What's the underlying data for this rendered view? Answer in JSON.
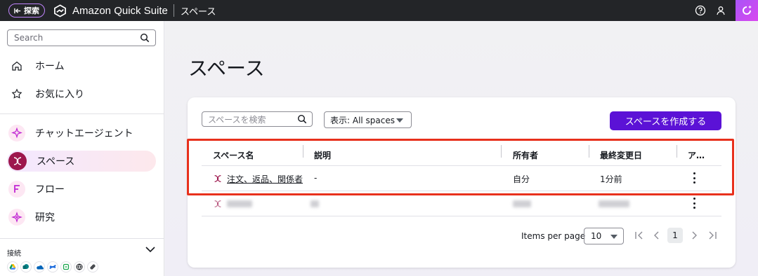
{
  "topbar": {
    "explore_label": "探索",
    "app_title": "Amazon Quick Suite",
    "page_crumb": "スペース",
    "icons": [
      "help-icon",
      "user-icon",
      "ai-assistant-icon"
    ]
  },
  "sidebar": {
    "search_placeholder": "Search",
    "items": [
      {
        "label": "ホーム",
        "icon": "home-icon"
      },
      {
        "label": "お気に入り",
        "icon": "star-icon"
      },
      {
        "label": "チャットエージェント",
        "icon": "chat-agent-icon"
      },
      {
        "label": "スペース",
        "icon": "spaces-icon",
        "active": true
      },
      {
        "label": "フロー",
        "icon": "flow-icon"
      },
      {
        "label": "研究",
        "icon": "research-icon"
      }
    ],
    "connections_label": "接続",
    "connectors": [
      "google-drive-icon",
      "sharepoint-icon",
      "onedrive-icon",
      "confluence-icon",
      "box-icon",
      "web-icon",
      "other-icon"
    ]
  },
  "main": {
    "title": "スペース",
    "search_placeholder": "スペースを検索",
    "filter_label": "表示: All spaces",
    "create_button": "スペースを作成する",
    "columns": [
      "スペース名",
      "説明",
      "所有者",
      "最終変更日",
      "ア…"
    ],
    "rows": [
      {
        "name": "注文、返品、関係者",
        "description": "-",
        "owner": "自分",
        "modified": "1分前",
        "blurred": false
      },
      {
        "name": "",
        "description": "",
        "owner": "",
        "modified": "",
        "blurred": true
      }
    ],
    "pagination": {
      "items_per_page_label": "Items per page",
      "items_per_page": "10",
      "current_page": "1"
    }
  },
  "colors": {
    "accent": "#5b12d6",
    "highlight": "#e8301c",
    "topbar": "#232528"
  }
}
